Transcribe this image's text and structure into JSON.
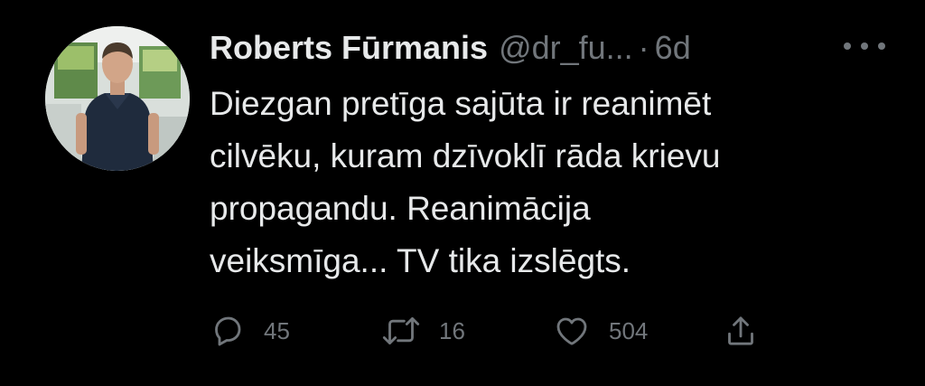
{
  "tweet": {
    "author": {
      "display_name": "Roberts Fūrmanis",
      "handle": "@dr_fu...",
      "separator": "·",
      "time": "6d"
    },
    "text": "Diezgan pretīga sajūta ir reanimēt\ncilvēku, kuram dzīvoklī rāda krievu\npropagandu. Reanimācija\nveiksmīga... TV tika izslēgts.",
    "stats": {
      "replies": "45",
      "retweets": "16",
      "likes": "504"
    }
  },
  "icons": {
    "more": "more-icon",
    "reply": "reply-icon",
    "retweet": "retweet-icon",
    "like": "heart-icon",
    "share": "share-icon"
  },
  "colors": {
    "background": "#000000",
    "primary_text": "#e7e9ea",
    "secondary_text": "#71767b"
  }
}
